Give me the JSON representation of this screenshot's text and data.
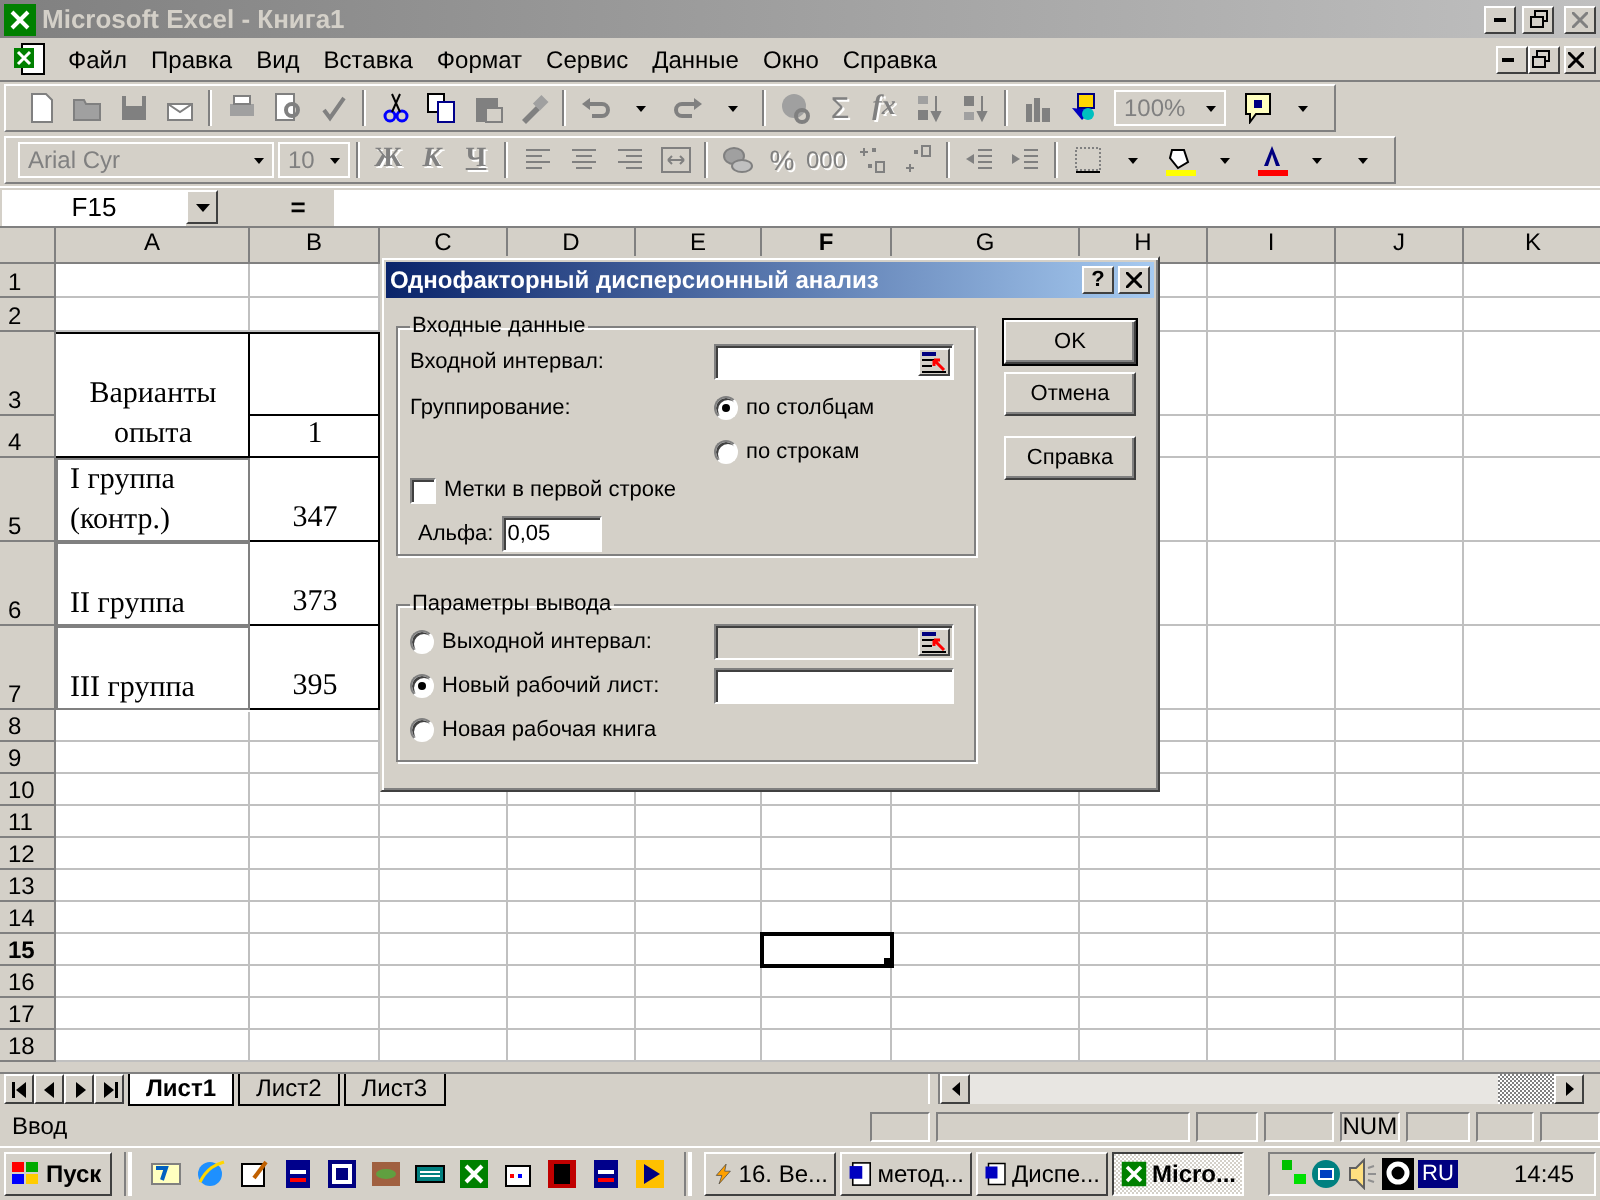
{
  "window": {
    "title": "Microsoft Excel - Книга1"
  },
  "menu": [
    "Файл",
    "Правка",
    "Вид",
    "Вставка",
    "Формат",
    "Сервис",
    "Данные",
    "Окно",
    "Справка"
  ],
  "standard_toolbar": {
    "buttons": [
      {
        "label": "Σ",
        "disabled": true
      },
      {
        "label": "fx",
        "disabled": true
      }
    ],
    "zoom": "100%"
  },
  "formatting_toolbar": {
    "font": "Arial Cyr",
    "size": "10",
    "buttons": [
      {
        "label": "Ж",
        "disabled": true
      },
      {
        "label": "К",
        "disabled": true
      },
      {
        "label": "Ч",
        "disabled": true
      },
      {
        "label": "%",
        "disabled": true
      },
      {
        "label": "000",
        "disabled": true
      }
    ]
  },
  "formula_bar": {
    "name_box": "F15",
    "equals": "="
  },
  "sheet": {
    "columns": [
      {
        "label": "A",
        "selected": false
      },
      {
        "label": "B",
        "selected": false
      },
      {
        "label": "C",
        "selected": false
      },
      {
        "label": "D",
        "selected": false
      },
      {
        "label": "E",
        "selected": false
      },
      {
        "label": "F",
        "selected": true
      },
      {
        "label": "G",
        "selected": false
      },
      {
        "label": "H",
        "selected": false
      },
      {
        "label": "I",
        "selected": false
      },
      {
        "label": "J",
        "selected": false
      },
      {
        "label": "K",
        "selected": false
      }
    ],
    "rows": [
      {
        "label": "1",
        "selected": false
      },
      {
        "label": "2",
        "selected": false
      },
      {
        "label": "3",
        "selected": false
      },
      {
        "label": "4",
        "selected": false
      },
      {
        "label": "5",
        "selected": false
      },
      {
        "label": "6",
        "selected": false
      },
      {
        "label": "7",
        "selected": false
      },
      {
        "label": "8",
        "selected": false
      },
      {
        "label": "9",
        "selected": false
      },
      {
        "label": "10",
        "selected": false
      },
      {
        "label": "11",
        "selected": false
      },
      {
        "label": "12",
        "selected": false
      },
      {
        "label": "13",
        "selected": false
      },
      {
        "label": "14",
        "selected": false
      },
      {
        "label": "15",
        "selected": true
      },
      {
        "label": "16",
        "selected": false
      },
      {
        "label": "17",
        "selected": false
      },
      {
        "label": "18",
        "selected": false
      }
    ],
    "table": {
      "header": "Варианты опыта",
      "header_value": "1",
      "rows": [
        {
          "group": "I группа (контр.)",
          "value": "347"
        },
        {
          "group": "II группа",
          "value": "373"
        },
        {
          "group": "III группа",
          "value": "395"
        }
      ]
    }
  },
  "dialog": {
    "title": "Однофакторный дисперсионный анализ",
    "help": "?",
    "input_group": {
      "title": "Входные данные",
      "input_range": {
        "label": "Входной интервал:",
        "disabled": false
      },
      "grouping": {
        "label": "Группирование:",
        "options": [
          {
            "label": "по столбцам",
            "selected": true
          },
          {
            "label": "по строкам",
            "selected": false
          }
        ]
      },
      "labels_checkbox": {
        "label": "Метки в первой строке",
        "checked": false
      },
      "alpha": {
        "label": "Альфа:",
        "value": "0,05"
      }
    },
    "output_group": {
      "title": "Параметры вывода",
      "options": [
        {
          "label": "Выходной интервал:",
          "selected": false,
          "field": {
            "disabled": true
          }
        },
        {
          "label": "Новый рабочий лист:",
          "selected": true,
          "field": {
            "disabled": false
          }
        },
        {
          "label": "Новая рабочая книга",
          "selected": false
        }
      ]
    },
    "buttons": [
      {
        "label": "OK",
        "default": true
      },
      {
        "label": "Отмена",
        "default": false
      },
      {
        "label": "Справка",
        "default": false
      }
    ]
  },
  "sheet_tabs": [
    {
      "label": "Лист1",
      "selected": true
    },
    {
      "label": "Лист2",
      "selected": false
    },
    {
      "label": "Лист3",
      "selected": false
    }
  ],
  "status_bar": {
    "mode": "Ввод",
    "indicators": [
      "NUM"
    ]
  },
  "taskbar": {
    "start": "Пуск",
    "tasks": [
      {
        "label": "16. Ве...",
        "selected": false
      },
      {
        "label": "метод...",
        "selected": false
      },
      {
        "label": "Диспе...",
        "selected": false
      },
      {
        "label": "Micro...",
        "selected": true
      }
    ],
    "language": "RU",
    "clock": "14:45"
  }
}
